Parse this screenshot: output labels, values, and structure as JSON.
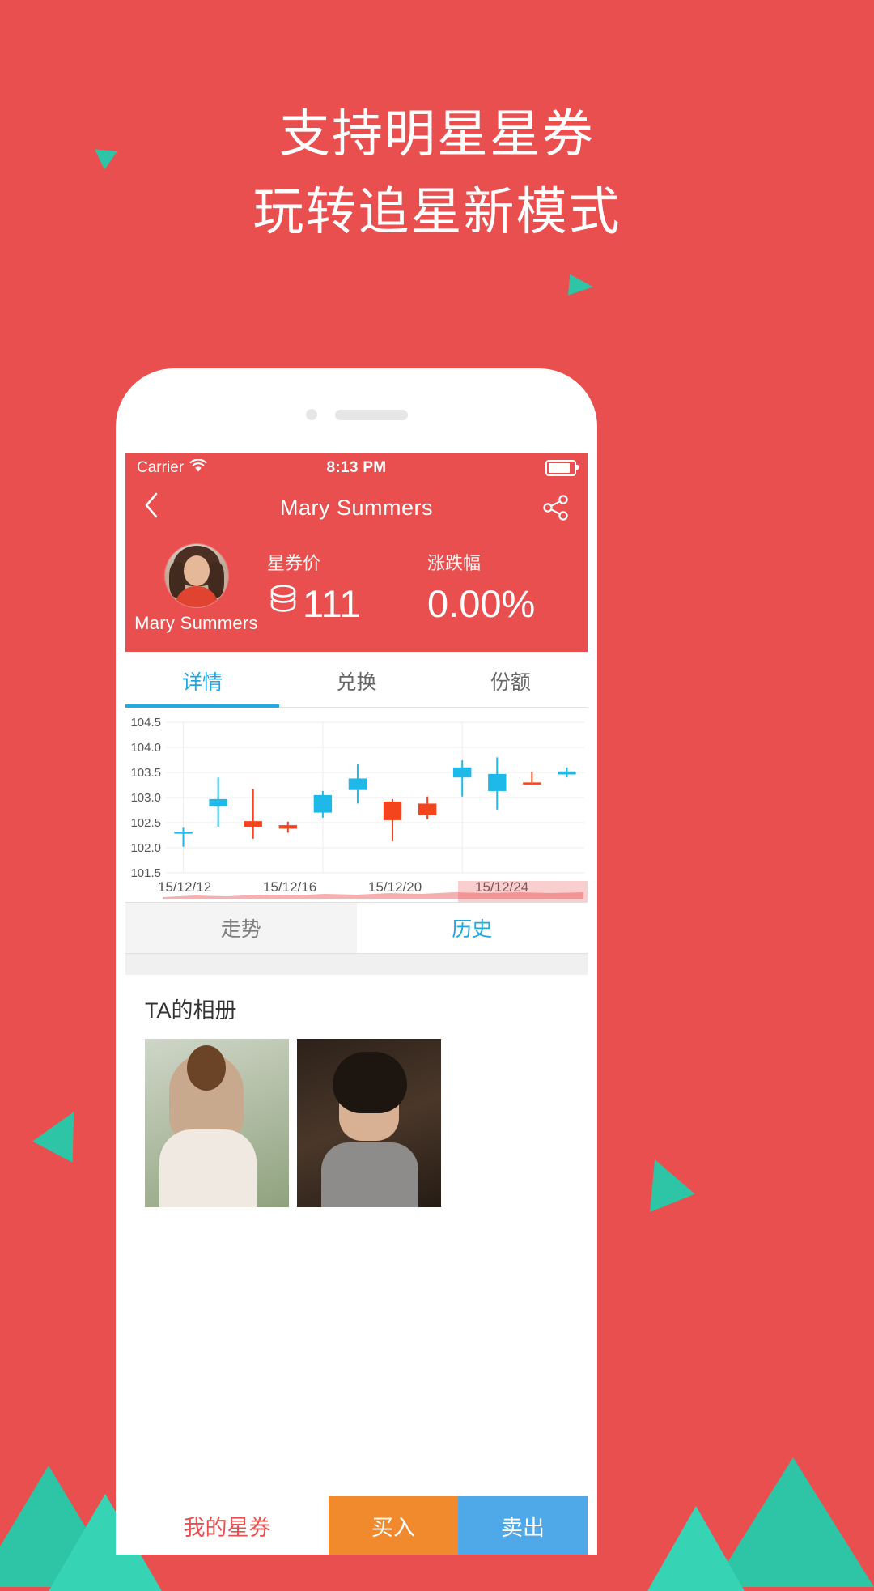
{
  "page": {
    "background_color": "#ea4f4f",
    "accent_teal": "#2ec4a6",
    "headline_line1": "支持明星星券",
    "headline_line2": "玩转追星新模式"
  },
  "status_bar": {
    "carrier": "Carrier",
    "wifi_icon": "wifi-icon",
    "time": "8:13 PM",
    "battery_icon": "battery-icon"
  },
  "nav_bar": {
    "back_icon": "chevron-left-icon",
    "title": "Mary Summers",
    "share_icon": "share-icon"
  },
  "profile": {
    "avatar_icon": "avatar",
    "name": "Mary Summers",
    "price_label": "星券价",
    "coin_icon": "coin-stack-icon",
    "price_value": "111",
    "change_label": "涨跌幅",
    "change_value": "0.00%"
  },
  "tabs": [
    {
      "label": "详情",
      "active": true
    },
    {
      "label": "兑换",
      "active": false
    },
    {
      "label": "份额",
      "active": false
    }
  ],
  "sub_tabs": [
    {
      "label": "走势",
      "active": false
    },
    {
      "label": "历史",
      "active": true
    }
  ],
  "album": {
    "title": "TA的相册",
    "photos": [
      "photo-woman-outdoor",
      "photo-woman-indoor"
    ]
  },
  "bottom_bar": {
    "my_coupons": "我的星券",
    "buy": "买入",
    "sell": "卖出"
  },
  "chart_data": {
    "type": "candlestick",
    "title": "",
    "xlabel": "",
    "ylabel": "",
    "ylim": [
      101.5,
      104.5
    ],
    "yticks": [
      "101.5",
      "102.0",
      "102.5",
      "103.0",
      "103.5",
      "104.0",
      "104.5"
    ],
    "xticks": [
      "15/12/12",
      "15/12/16",
      "15/12/20",
      "15/12/24"
    ],
    "grid": true,
    "up_color": "#1eb9e8",
    "down_color": "#f4441e",
    "candles": [
      {
        "open": 102.32,
        "close": 102.32,
        "high": 102.4,
        "low": 102.02,
        "dir": "up"
      },
      {
        "open": 102.82,
        "close": 102.97,
        "high": 103.4,
        "low": 102.42,
        "dir": "up"
      },
      {
        "open": 102.53,
        "close": 102.42,
        "high": 103.17,
        "low": 102.18,
        "dir": "down"
      },
      {
        "open": 102.45,
        "close": 102.38,
        "high": 102.52,
        "low": 102.3,
        "dir": "down"
      },
      {
        "open": 102.7,
        "close": 103.05,
        "high": 103.13,
        "low": 102.6,
        "dir": "up"
      },
      {
        "open": 103.15,
        "close": 103.38,
        "high": 103.66,
        "low": 102.88,
        "dir": "up"
      },
      {
        "open": 102.92,
        "close": 102.55,
        "high": 102.97,
        "low": 102.13,
        "dir": "down"
      },
      {
        "open": 102.88,
        "close": 102.65,
        "high": 103.02,
        "low": 102.57,
        "dir": "down"
      },
      {
        "open": 103.4,
        "close": 103.6,
        "high": 103.74,
        "low": 103.02,
        "dir": "up"
      },
      {
        "open": 103.13,
        "close": 103.47,
        "high": 103.8,
        "low": 102.76,
        "dir": "up"
      },
      {
        "open": 103.3,
        "close": 103.3,
        "high": 103.52,
        "low": 103.3,
        "dir": "down"
      },
      {
        "open": 103.46,
        "close": 103.52,
        "high": 103.6,
        "low": 103.4,
        "dir": "up"
      }
    ]
  }
}
